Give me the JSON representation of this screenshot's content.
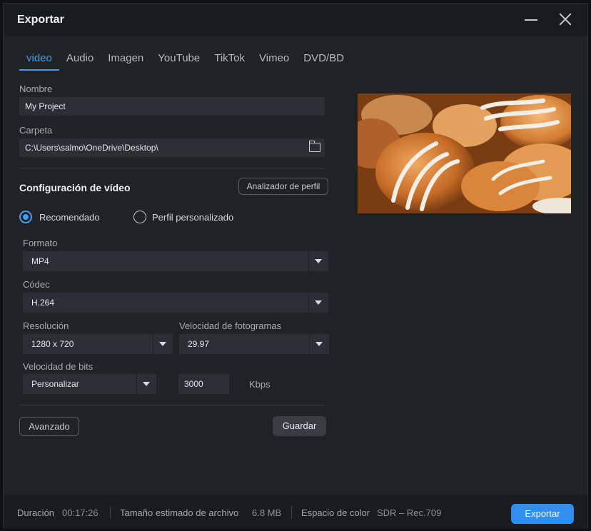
{
  "window": {
    "title": "Exportar"
  },
  "tabs": [
    "video",
    "Audio",
    "Imagen",
    "YouTube",
    "TikTok",
    "Vimeo",
    "DVD/BD"
  ],
  "active_tab": "video",
  "name": {
    "label": "Nombre",
    "value": "My Project"
  },
  "folder": {
    "label": "Carpeta",
    "value": "C:\\Users\\salmo\\OneDrive\\Desktop\\"
  },
  "video_config": {
    "title": "Configuración de vídeo",
    "profile_analyzer": "Analizador de perfil",
    "radio_recommended": "Recomendado",
    "radio_custom": "Perfil personalizado",
    "selected_profile": "Recomendado"
  },
  "format": {
    "label": "Formato",
    "value": "MP4"
  },
  "codec": {
    "label": "Códec",
    "value": "H.264"
  },
  "resolution": {
    "label": "Resolución",
    "value": "1280 x 720"
  },
  "framerate": {
    "label": "Velocidad de fotogramas",
    "value": "29.97"
  },
  "bitrate": {
    "label": "Velocidad de bits",
    "mode": "Personalizar",
    "value": "3000",
    "unit": "Kbps"
  },
  "buttons": {
    "advanced": "Avanzado",
    "save": "Guardar",
    "export": "Exportar"
  },
  "footer": {
    "duration_label": "Duración",
    "duration_value": "00:17:26",
    "size_label": "Tamaño estimado de archivo",
    "size_value": "6.8 MB",
    "color_label": "Espacio de color",
    "color_value": "SDR – Rec.709"
  },
  "colors": {
    "accent": "#3f9cf5",
    "export_button": "#2f8ef0",
    "background": "#212226"
  },
  "icons": {
    "minimize": "minimize-icon",
    "close": "close-icon",
    "folder": "folder-open-icon",
    "dropdown": "chevron-down-icon"
  }
}
